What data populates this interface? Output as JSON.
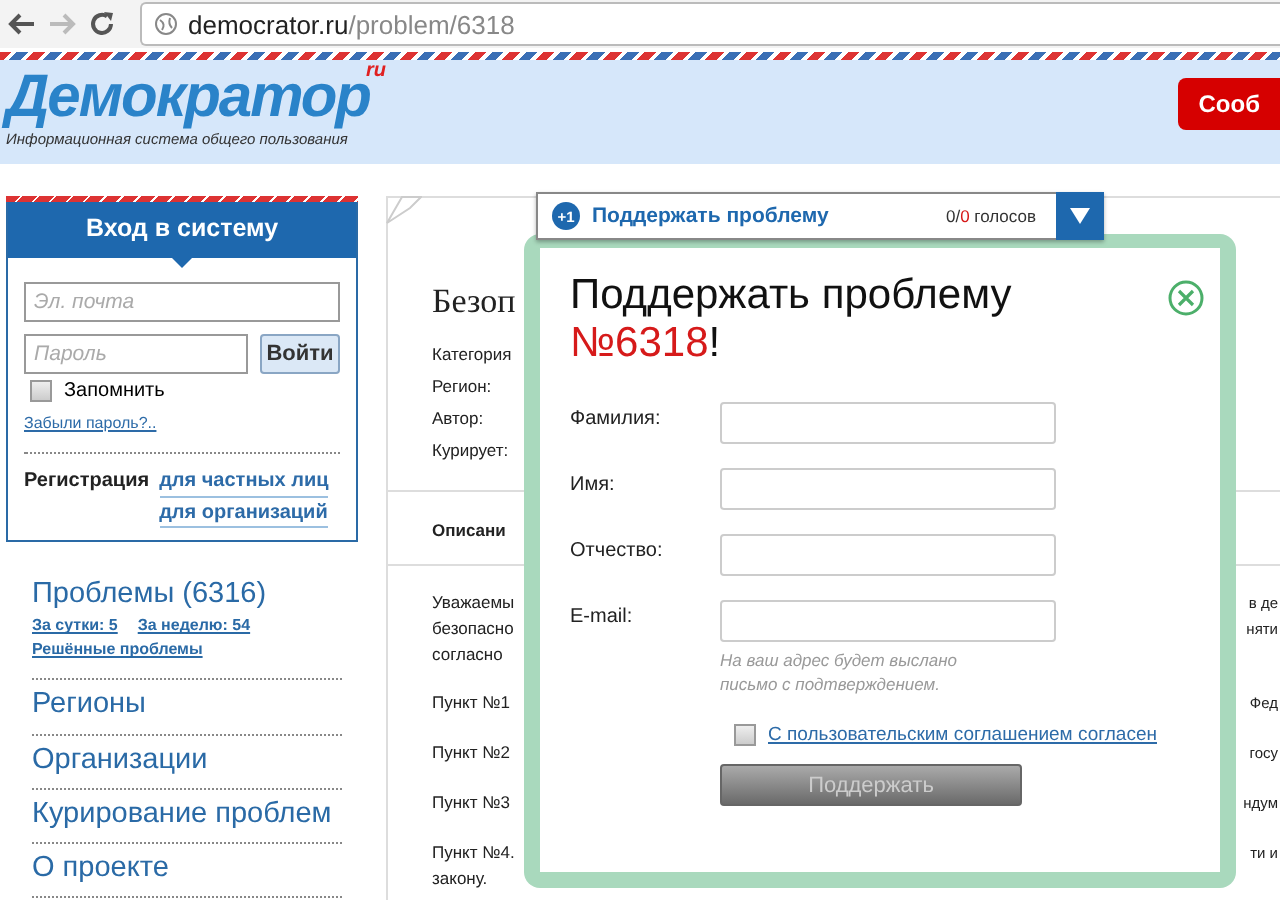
{
  "browser": {
    "url_host": "democrator.ru",
    "url_path": "/problem/6318"
  },
  "header": {
    "logo": "Демократор",
    "logo_suffix": "ru",
    "tagline": "Информационная система общего пользования",
    "button": "Сооб"
  },
  "login": {
    "title": "Вход в систему",
    "email_placeholder": "Эл. почта",
    "password_placeholder": "Пароль",
    "submit": "Войти",
    "remember": {
      "label": "Запомнить",
      "checked": false
    },
    "forgot": "Забыли пароль?..",
    "register_label": "Регистрация",
    "register_links": [
      "для частных лиц",
      "для организаций"
    ]
  },
  "nav": {
    "problems": "Проблемы (6316)",
    "problem_links": [
      "За сутки: 5",
      "За неделю: 54"
    ],
    "solved_link": "Решённые проблемы",
    "items": [
      "Регионы",
      "Организации",
      "Курирование проблем",
      "О проекте"
    ]
  },
  "problem": {
    "title": "Безоп",
    "meta": [
      "Категория",
      "Регион:",
      "Автор:",
      "Курирует:"
    ],
    "tab": "Описани",
    "paragraphs": [
      {
        "lines": [
          {
            "left": "Уважаемы",
            "right": "в де"
          },
          {
            "left": "безопасно",
            "right": "няти"
          },
          {
            "left": "согласно"
          }
        ]
      },
      {
        "lines": [
          {
            "left": "Пункт №1",
            "right": "Фед"
          }
        ]
      },
      {
        "lines": [
          {
            "left": "Пункт №2",
            "right": "госу"
          }
        ]
      },
      {
        "lines": [
          {
            "left": "Пункт №3",
            "right": "ндум"
          }
        ]
      },
      {
        "lines": [
          {
            "left": "Пункт №4.",
            "right": "ти и"
          },
          {
            "left": "закону."
          }
        ]
      }
    ]
  },
  "support_bar": {
    "badge": "+1",
    "label": "Поддержать проблему",
    "votes_prefix": "0/",
    "votes_highlight": "0",
    "votes_suffix": " голосов"
  },
  "modal": {
    "title": "Поддержать проблему",
    "number": "№6318",
    "exclamation": "!",
    "fields": [
      {
        "label": "Фамилия:"
      },
      {
        "label": "Имя:"
      },
      {
        "label": "Отчество:"
      },
      {
        "label": "E-mail:",
        "hint": "На ваш адрес будет выслано письмо с подтверждением."
      }
    ],
    "agreement": {
      "label": "С пользовательским соглашением согласен",
      "checked": false
    },
    "submit": {
      "label": "Поддержать",
      "disabled": true
    }
  }
}
